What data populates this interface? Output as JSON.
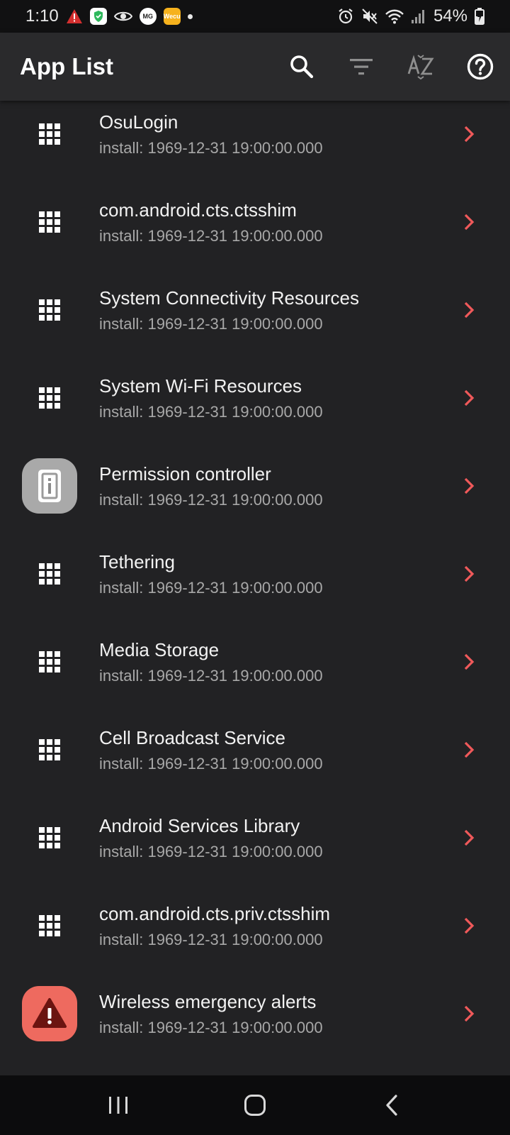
{
  "status_bar": {
    "time": "1:10",
    "battery": "54%",
    "badge_mg": "MG",
    "badge_wecc": "Wecu"
  },
  "app_bar": {
    "title": "App List",
    "actions": [
      "search-icon",
      "filter-icon",
      "sort-az-icon",
      "help-icon"
    ]
  },
  "colors": {
    "chevron": "#f0595a",
    "warning_icon_bg": "#ee6a5f"
  },
  "list": {
    "items": [
      {
        "name": "OsuLogin",
        "sub": "install: 1969-12-31 19:00:00.000",
        "icon": "grid-icon"
      },
      {
        "name": "com.android.cts.ctsshim",
        "sub": "install: 1969-12-31 19:00:00.000",
        "icon": "grid-icon"
      },
      {
        "name": "System Connectivity Resources",
        "sub": "install: 1969-12-31 19:00:00.000",
        "icon": "grid-icon"
      },
      {
        "name": "System Wi-Fi Resources",
        "sub": "install: 1969-12-31 19:00:00.000",
        "icon": "grid-icon"
      },
      {
        "name": "Permission controller",
        "sub": "install: 1969-12-31 19:00:00.000",
        "icon": "permission-controller-icon"
      },
      {
        "name": "Tethering",
        "sub": "install: 1969-12-31 19:00:00.000",
        "icon": "grid-icon"
      },
      {
        "name": "Media Storage",
        "sub": "install: 1969-12-31 19:00:00.000",
        "icon": "grid-icon"
      },
      {
        "name": "Cell Broadcast Service",
        "sub": "install: 1969-12-31 19:00:00.000",
        "icon": "grid-icon"
      },
      {
        "name": "Android Services Library",
        "sub": "install: 1969-12-31 19:00:00.000",
        "icon": "grid-icon"
      },
      {
        "name": "com.android.cts.priv.ctsshim",
        "sub": "install: 1969-12-31 19:00:00.000",
        "icon": "grid-icon"
      },
      {
        "name": "Wireless emergency alerts",
        "sub": "install: 1969-12-31 19:00:00.000",
        "icon": "emergency-alert-icon"
      }
    ]
  },
  "nav_bar": {
    "buttons": [
      "recents-icon",
      "home-icon",
      "back-icon"
    ]
  }
}
